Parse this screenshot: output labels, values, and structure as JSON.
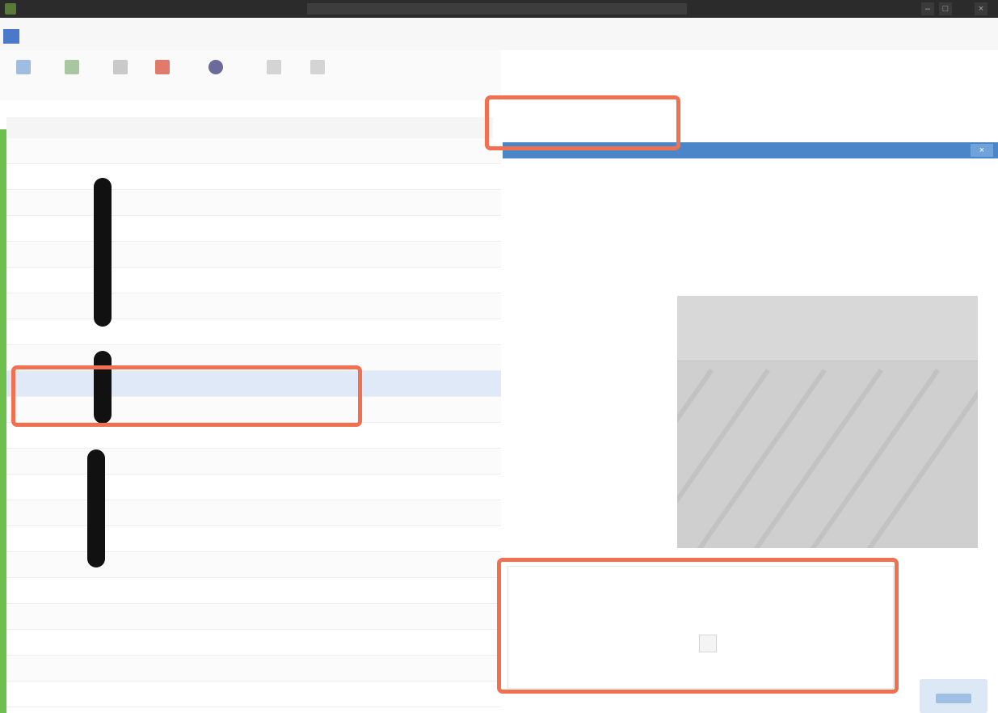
{
  "window": {
    "title": ""
  },
  "menubar": {
    "items": [
      {
        "label": "",
        "active": true
      },
      {
        "label": ""
      },
      {
        "label": ""
      },
      {
        "label": ""
      }
    ]
  },
  "toolbar": {
    "tools": [
      {
        "label": "",
        "icon": "open-icon",
        "color": "#9fbde0"
      },
      {
        "label": "",
        "icon": "save-icon",
        "color": "#a8c7a0"
      },
      {
        "label": "",
        "icon": "copy-icon",
        "color": "#c9c9c9"
      },
      {
        "label": "",
        "icon": "delete-icon",
        "color": "#e07a6a"
      },
      {
        "label": "",
        "icon": "user-icon",
        "color": "#6b6b9a"
      },
      {
        "label": "",
        "icon": "arrow-icon",
        "color": "#d4d4d4"
      },
      {
        "label": "",
        "icon": "info-icon",
        "color": "#d4d4d4"
      }
    ],
    "groups": [
      "",
      "",
      ""
    ]
  },
  "grid": {
    "columns": [
      "",
      "",
      "",
      ""
    ],
    "rows": [
      {
        "name": "",
        "a": "",
        "b": "",
        "c": ""
      },
      {
        "name": "",
        "a": "",
        "b": "",
        "c": ""
      },
      {
        "name": "",
        "a": "",
        "b": "",
        "c": ""
      },
      {
        "name": "",
        "a": "",
        "b": "",
        "c": ""
      },
      {
        "name": "",
        "a": "",
        "b": "",
        "c": ""
      },
      {
        "name": "",
        "a": "",
        "b": "",
        "c": ""
      },
      {
        "name": "",
        "a": "",
        "b": "",
        "c": ""
      },
      {
        "name": "",
        "a": "",
        "b": "",
        "c": ""
      },
      {
        "name": "",
        "a": "",
        "b": "",
        "c": ""
      },
      {
        "name": "",
        "a": "",
        "b": "",
        "c": "",
        "selected": true
      },
      {
        "name": "",
        "a": "",
        "b": "",
        "c": ""
      },
      {
        "name": "",
        "a": "",
        "b": "",
        "c": ""
      },
      {
        "name": "",
        "a": "",
        "b": "",
        "c": ""
      },
      {
        "name": "",
        "a": "",
        "b": "",
        "c": ""
      },
      {
        "name": "",
        "a": "",
        "b": "",
        "c": ""
      },
      {
        "name": "",
        "a": "",
        "b": "",
        "c": ""
      },
      {
        "name": "",
        "a": "",
        "b": "",
        "c": ""
      },
      {
        "name": "",
        "a": "",
        "b": "",
        "c": ""
      },
      {
        "name": "",
        "a": "",
        "b": "",
        "c": ""
      },
      {
        "name": "",
        "a": "",
        "b": "",
        "c": ""
      },
      {
        "name": "",
        "a": "",
        "b": "",
        "c": ""
      },
      {
        "name": "",
        "a": "",
        "b": "",
        "c": ""
      }
    ]
  },
  "search_field": {
    "value": ""
  },
  "properties": {
    "items": [
      "",
      "",
      "",
      "",
      "",
      "",
      ""
    ]
  },
  "details": {
    "lines": [
      "",
      "",
      "",
      ""
    ]
  },
  "dialog": {
    "title": "",
    "subtitle": "",
    "button_label": "",
    "note": ""
  },
  "colors": {
    "highlight": "#f07050",
    "accent": "#4a86c8",
    "side_accent": "#6fbf4f",
    "redaction": "#111111"
  }
}
